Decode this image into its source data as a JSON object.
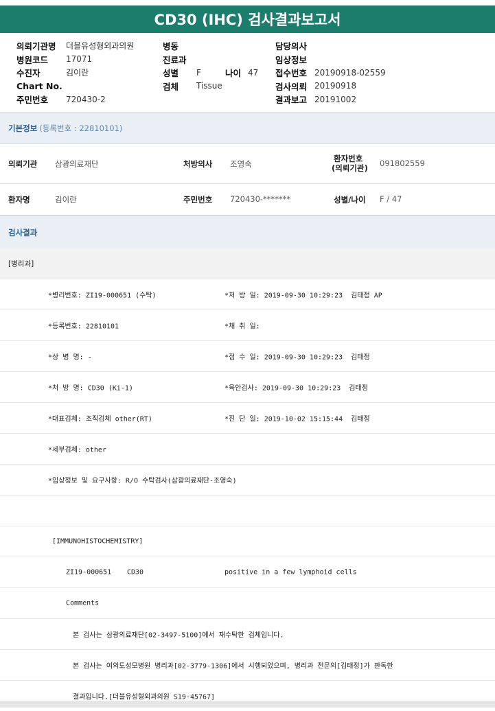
{
  "report": {
    "title": "CD30 (IHC) 검사결과보고서"
  },
  "header": {
    "col1": [
      {
        "label": "의뢰기관명",
        "value": "더블유성형외과의원"
      },
      {
        "label": "병원코드",
        "value": "17071"
      },
      {
        "label": "수진자",
        "value": "김이란"
      },
      {
        "label": "Chart No.",
        "value": ""
      },
      {
        "label": "주민번호",
        "value": "720430-2"
      }
    ],
    "col2": [
      {
        "label": "병동",
        "value": ""
      },
      {
        "label": "진료과",
        "value": ""
      },
      {
        "label": "성별",
        "value": "F",
        "label2": "나이",
        "value2": "47"
      },
      {
        "label": "검체",
        "value": "Tissue"
      }
    ],
    "col3": [
      {
        "label": "담당의사",
        "value": ""
      },
      {
        "label": "임상정보",
        "value": ""
      },
      {
        "label": "접수번호",
        "value": "20190918-02559"
      },
      {
        "label": "검사의뢰",
        "value": "20190918"
      },
      {
        "label": "결과보고",
        "value": "20191002"
      }
    ]
  },
  "basic_info": {
    "title": "기본정보",
    "reg_text": "(등록번호 : 22810101)",
    "row1": {
      "institution_label": "의뢰기관",
      "institution_value": "삼광의료재단",
      "doctor_label": "처방의사",
      "doctor_value": "조영숙",
      "patient_no_label_1": "환자번호",
      "patient_no_label_2": "(의뢰기관)",
      "patient_no_value": "091802559"
    },
    "row2": {
      "name_label": "환자명",
      "name_value": "김이란",
      "id_label": "주민번호",
      "id_value": "720430-*******",
      "sexage_label": "성별/나이",
      "sexage_value": "F / 47"
    }
  },
  "results": {
    "title": "검사결과",
    "dept": "[병리과]",
    "lines": [
      {
        "left": "*병리번호: ZI19-000651 (수탁)",
        "right": "*처 방 일: 2019-09-30 10:29:23  김태정 AP"
      },
      {
        "left": "*등록번호: 22810101",
        "right": "*채 취 일:"
      },
      {
        "left": "*상 병 명: -",
        "right": "*접 수 일: 2019-09-30 10:29:23  김태정"
      },
      {
        "left": "*처 방 명: CD30 (Ki-1)",
        "right": "*육안검사: 2019-09-30 10:29:23  김태정"
      },
      {
        "left": "*대표검체: 조직검체 other(RT)",
        "right": "*진 단 일: 2019-10-02 15:15:44  김태정"
      },
      {
        "left": "*세부검체: other",
        "right": ""
      },
      {
        "left": "*임상정보 및 요구사항: R/O 수탁검사(삼광의료재단-조영숙)",
        "right": ""
      }
    ],
    "ihc_header": "[IMMUNOHISTOCHEMISTRY]",
    "ihc_row": {
      "specimen": "ZI19-000651",
      "marker": "CD30",
      "result": "positive in a few lymphoid cells"
    },
    "comments_label": "Comments",
    "comment1": "본 검사는 삼광의료재단[02-3497-5100]에서 재수탁한 검체입니다.",
    "comment2": "본 검사는 여의도성모병원 병리과[02-3779-1306]에서 시행되었으며, 병리과 전문의[김태정]가 판독한",
    "comment3": "결과입니다.[더블유성형외과의원 S19-45767]"
  }
}
